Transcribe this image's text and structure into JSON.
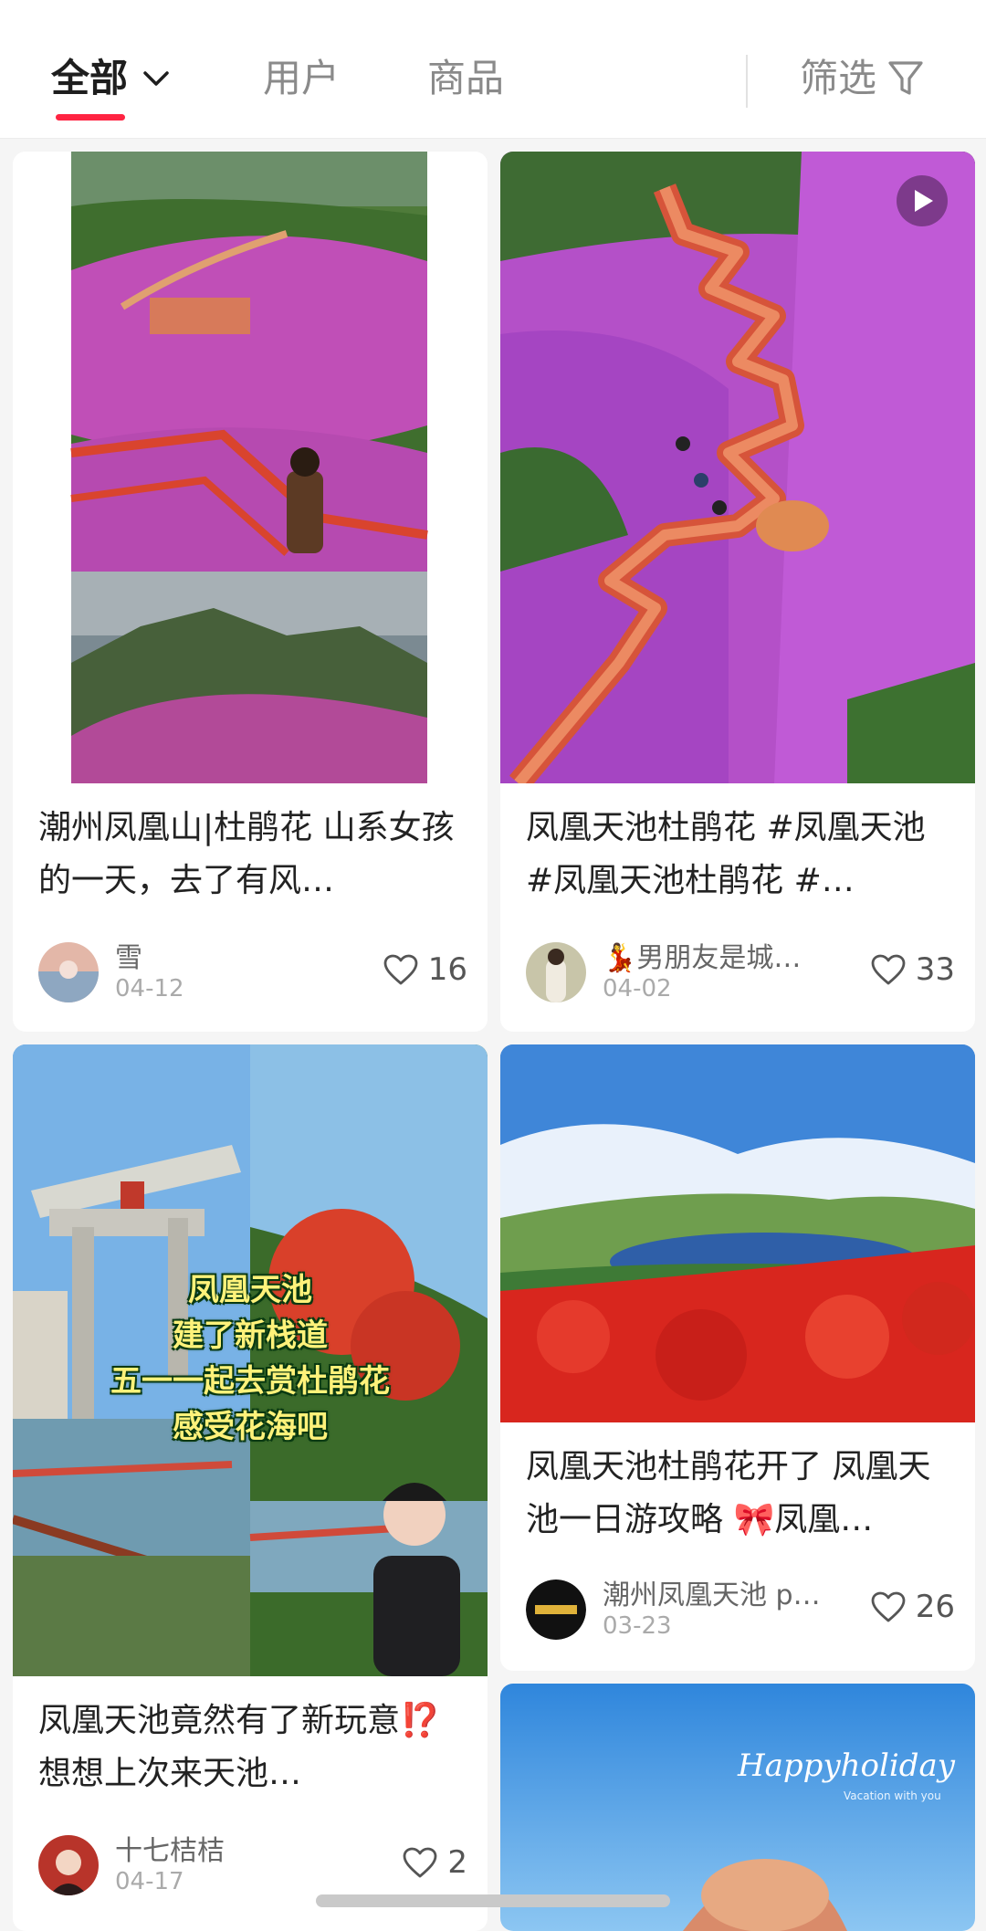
{
  "tabs": {
    "all": "全部",
    "users": "用户",
    "goods": "商品",
    "filter": "筛选"
  },
  "colors": {
    "accent": "#ff2442"
  },
  "cards": [
    {
      "title": "潮州凤凰山|杜鹃花 山系女孩的一天，去了有风…",
      "author": "雪",
      "date": "04-12",
      "likes": "16",
      "has_video": false
    },
    {
      "title": "凤凰天池杜鹃花 #凤凰天池 #凤凰天池杜鹃花 #…",
      "author_emoji": "💃",
      "author": "男朋友是城…",
      "date": "04-02",
      "likes": "33",
      "has_video": true
    },
    {
      "title": "凤凰天池竟然有了新玩意⁉️ 想想上次来天池…",
      "author": "十七桔桔",
      "date": "04-17",
      "likes": "2",
      "overlay": [
        "凤凰天池",
        "建了新栈道",
        "五一一起去赏杜鹃花",
        "感受花海吧"
      ],
      "has_video": false
    },
    {
      "title": "凤凰天池杜鹃花开了 凤凰天池一日游攻略 🎀凤凰…",
      "author": "潮州凤凰天池 p…",
      "date": "03-23",
      "likes": "26",
      "has_video": false
    },
    {
      "cover_text": "Happyholiday",
      "cover_subtext": "Vacation with you"
    }
  ]
}
